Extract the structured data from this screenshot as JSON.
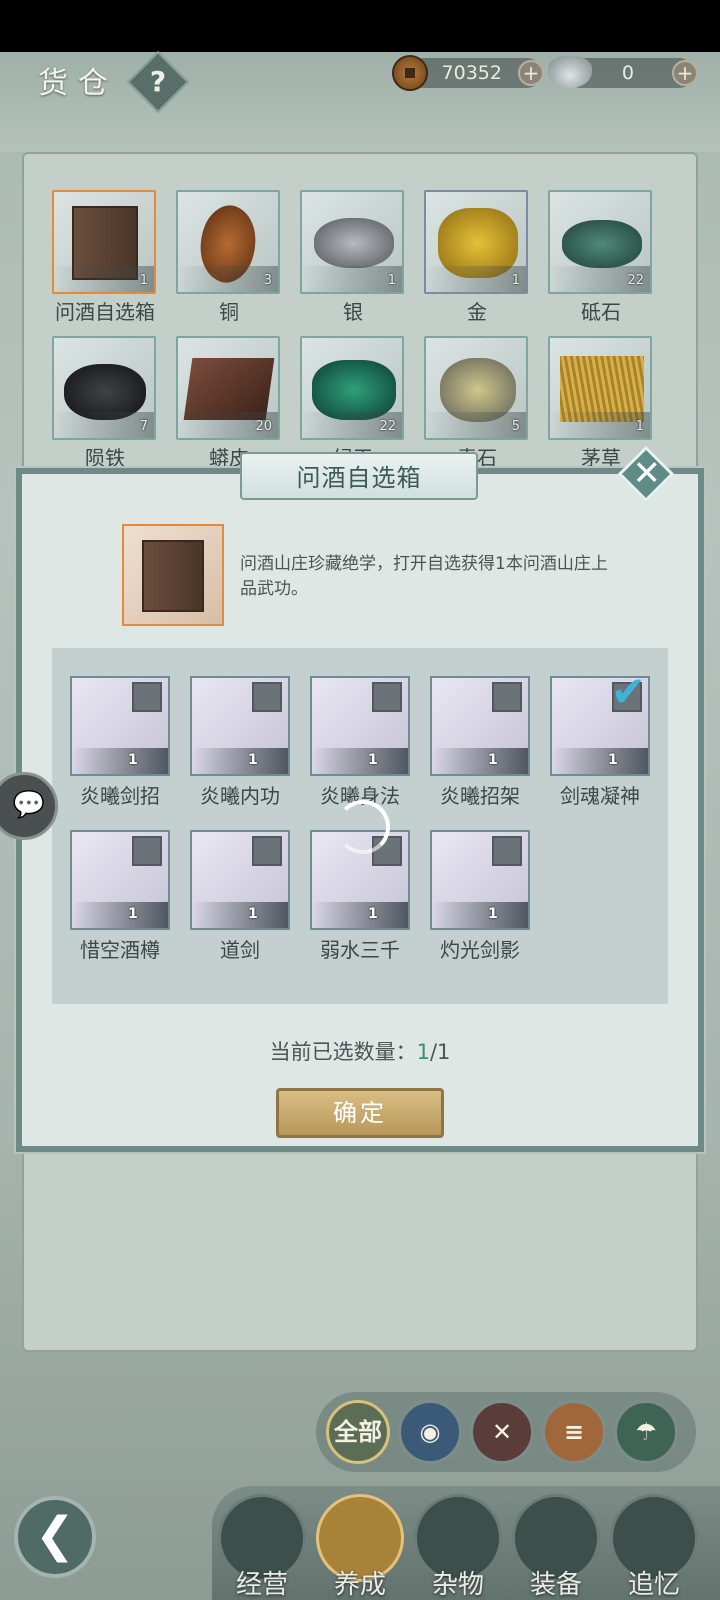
{
  "header": {
    "title": "货仓",
    "help_label": "?",
    "copper": "70352",
    "silver": "0",
    "add_label": "+"
  },
  "inventory": {
    "items": [
      {
        "name": "问酒自选箱",
        "count": "1"
      },
      {
        "name": "铜",
        "count": "3"
      },
      {
        "name": "银",
        "count": "1"
      },
      {
        "name": "金",
        "count": "1"
      },
      {
        "name": "砥石",
        "count": "22"
      },
      {
        "name": "陨铁",
        "count": "7"
      },
      {
        "name": "蟒皮",
        "count": "20"
      },
      {
        "name": "绿玉",
        "count": "22"
      },
      {
        "name": "青石",
        "count": "5"
      },
      {
        "name": "茅草",
        "count": "1"
      }
    ]
  },
  "dialog": {
    "title": "问酒自选箱",
    "close_label": "✕",
    "description": "问酒山庄珍藏绝学，打开自选获得1本问酒山庄上品武功。",
    "skills": [
      {
        "name": "炎曦剑招",
        "count": "1",
        "checked": false
      },
      {
        "name": "炎曦内功",
        "count": "1",
        "checked": false
      },
      {
        "name": "炎曦身法",
        "count": "1",
        "checked": false
      },
      {
        "name": "炎曦招架",
        "count": "1",
        "checked": false
      },
      {
        "name": "剑魂凝神",
        "count": "1",
        "checked": true
      },
      {
        "name": "惜空酒樽",
        "count": "1",
        "checked": false
      },
      {
        "name": "道剑",
        "count": "1",
        "checked": false
      },
      {
        "name": "弱水三千",
        "count": "1",
        "checked": false
      },
      {
        "name": "灼光剑影",
        "count": "1",
        "checked": false
      }
    ],
    "count_label": "当前已选数量：",
    "count_selected": "1",
    "count_total": "/1",
    "confirm_label": "确定",
    "check_mark": "✔"
  },
  "filters": [
    {
      "label": "全部",
      "color": "#5b6e55",
      "active": true
    },
    {
      "label": "",
      "color": "#3b5a78"
    },
    {
      "label": "",
      "color": "#5a3d3a"
    },
    {
      "label": "",
      "color": "#a0683a"
    },
    {
      "label": "",
      "color": "#3f6456"
    }
  ],
  "nav": [
    {
      "label": "经营"
    },
    {
      "label": "养成"
    },
    {
      "label": "杂物"
    },
    {
      "label": "装备"
    },
    {
      "label": "追忆"
    }
  ],
  "chat_label": "💬",
  "back_label": "❮"
}
